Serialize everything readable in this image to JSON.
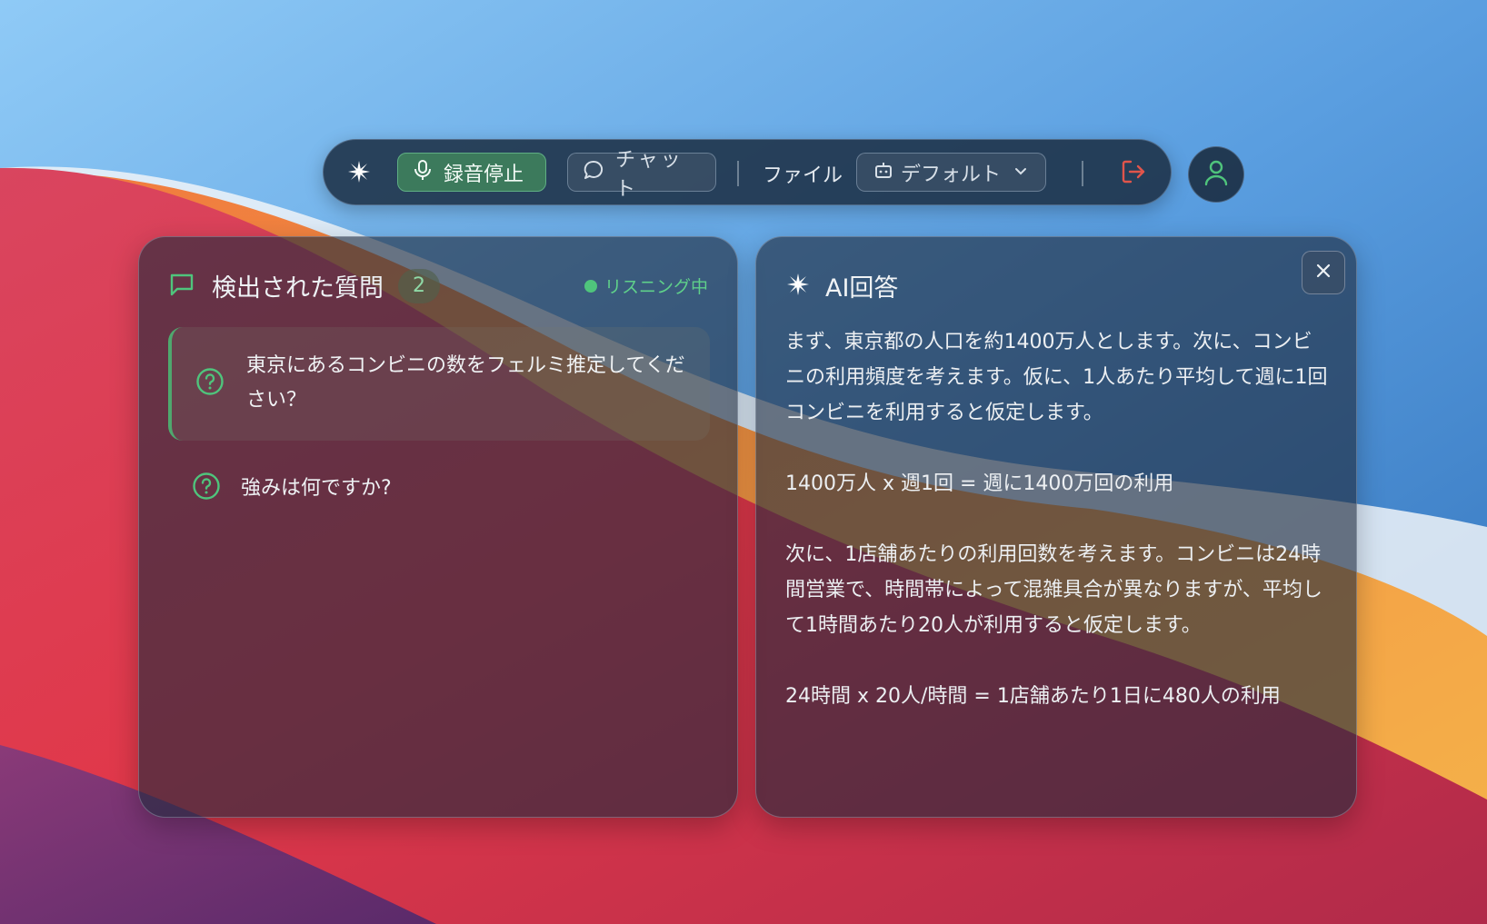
{
  "toolbar": {
    "record_label": "録音停止",
    "chat_label": "チャット",
    "file_label": "ファイル",
    "profile_label": "デフォルト"
  },
  "questions_panel": {
    "title": "検出された質問",
    "count": "2",
    "status": "リスニング中",
    "questions": [
      "東京にあるコンビニの数をフェルミ推定してください？",
      "強みは何ですか?"
    ]
  },
  "answer_panel": {
    "title": "AI回答",
    "paragraphs": [
      "まず、東京都の人口を約1400万人とします。次に、コンビニの利用頻度を考えます。仮に、1人あたり平均して週に1回コンビニを利用すると仮定します。",
      "1400万人 x 週1回 = 週に1400万回の利用",
      "次に、1店舗あたりの利用回数を考えます。コンビニは24時間営業で、時間帯によって混雑具合が異なりますが、平均して1時間あたり20人が利用すると仮定します。",
      "24時間 x 20人/時間 = 1店舗あたり1日に480人の利用"
    ]
  },
  "colors": {
    "accent_green": "#4fc47c",
    "logout_red": "#e0554b"
  },
  "icons": [
    "sparkle-logo-icon",
    "microphone-icon",
    "chat-bubble-icon",
    "robot-icon",
    "chevron-down-icon",
    "logout-icon",
    "user-icon",
    "message-square-icon",
    "question-circle-icon",
    "close-icon"
  ]
}
